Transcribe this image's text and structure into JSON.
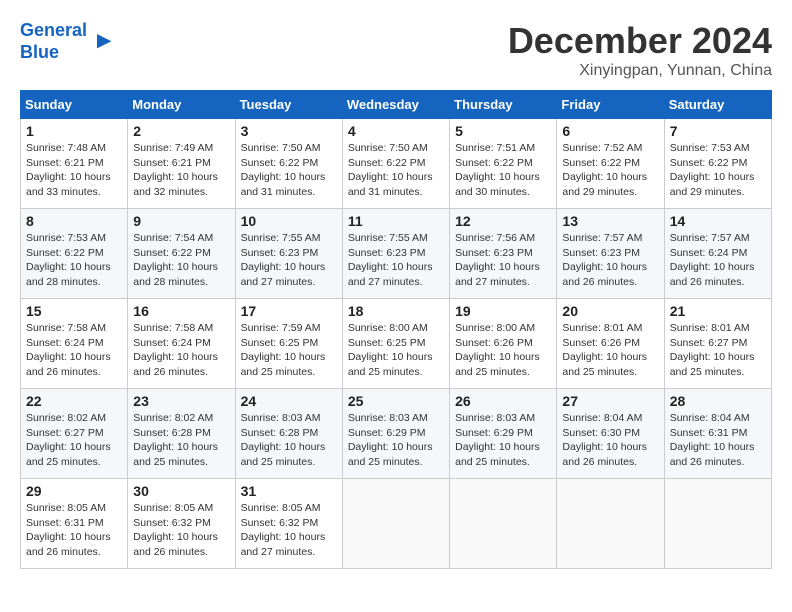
{
  "header": {
    "logo_line1": "General",
    "logo_line2": "Blue",
    "month": "December 2024",
    "location": "Xinyingpan, Yunnan, China"
  },
  "weekdays": [
    "Sunday",
    "Monday",
    "Tuesday",
    "Wednesday",
    "Thursday",
    "Friday",
    "Saturday"
  ],
  "weeks": [
    [
      {
        "day": "1",
        "info": "Sunrise: 7:48 AM\nSunset: 6:21 PM\nDaylight: 10 hours\nand 33 minutes."
      },
      {
        "day": "2",
        "info": "Sunrise: 7:49 AM\nSunset: 6:21 PM\nDaylight: 10 hours\nand 32 minutes."
      },
      {
        "day": "3",
        "info": "Sunrise: 7:50 AM\nSunset: 6:22 PM\nDaylight: 10 hours\nand 31 minutes."
      },
      {
        "day": "4",
        "info": "Sunrise: 7:50 AM\nSunset: 6:22 PM\nDaylight: 10 hours\nand 31 minutes."
      },
      {
        "day": "5",
        "info": "Sunrise: 7:51 AM\nSunset: 6:22 PM\nDaylight: 10 hours\nand 30 minutes."
      },
      {
        "day": "6",
        "info": "Sunrise: 7:52 AM\nSunset: 6:22 PM\nDaylight: 10 hours\nand 29 minutes."
      },
      {
        "day": "7",
        "info": "Sunrise: 7:53 AM\nSunset: 6:22 PM\nDaylight: 10 hours\nand 29 minutes."
      }
    ],
    [
      {
        "day": "8",
        "info": "Sunrise: 7:53 AM\nSunset: 6:22 PM\nDaylight: 10 hours\nand 28 minutes."
      },
      {
        "day": "9",
        "info": "Sunrise: 7:54 AM\nSunset: 6:22 PM\nDaylight: 10 hours\nand 28 minutes."
      },
      {
        "day": "10",
        "info": "Sunrise: 7:55 AM\nSunset: 6:23 PM\nDaylight: 10 hours\nand 27 minutes."
      },
      {
        "day": "11",
        "info": "Sunrise: 7:55 AM\nSunset: 6:23 PM\nDaylight: 10 hours\nand 27 minutes."
      },
      {
        "day": "12",
        "info": "Sunrise: 7:56 AM\nSunset: 6:23 PM\nDaylight: 10 hours\nand 27 minutes."
      },
      {
        "day": "13",
        "info": "Sunrise: 7:57 AM\nSunset: 6:23 PM\nDaylight: 10 hours\nand 26 minutes."
      },
      {
        "day": "14",
        "info": "Sunrise: 7:57 AM\nSunset: 6:24 PM\nDaylight: 10 hours\nand 26 minutes."
      }
    ],
    [
      {
        "day": "15",
        "info": "Sunrise: 7:58 AM\nSunset: 6:24 PM\nDaylight: 10 hours\nand 26 minutes."
      },
      {
        "day": "16",
        "info": "Sunrise: 7:58 AM\nSunset: 6:24 PM\nDaylight: 10 hours\nand 26 minutes."
      },
      {
        "day": "17",
        "info": "Sunrise: 7:59 AM\nSunset: 6:25 PM\nDaylight: 10 hours\nand 25 minutes."
      },
      {
        "day": "18",
        "info": "Sunrise: 8:00 AM\nSunset: 6:25 PM\nDaylight: 10 hours\nand 25 minutes."
      },
      {
        "day": "19",
        "info": "Sunrise: 8:00 AM\nSunset: 6:26 PM\nDaylight: 10 hours\nand 25 minutes."
      },
      {
        "day": "20",
        "info": "Sunrise: 8:01 AM\nSunset: 6:26 PM\nDaylight: 10 hours\nand 25 minutes."
      },
      {
        "day": "21",
        "info": "Sunrise: 8:01 AM\nSunset: 6:27 PM\nDaylight: 10 hours\nand 25 minutes."
      }
    ],
    [
      {
        "day": "22",
        "info": "Sunrise: 8:02 AM\nSunset: 6:27 PM\nDaylight: 10 hours\nand 25 minutes."
      },
      {
        "day": "23",
        "info": "Sunrise: 8:02 AM\nSunset: 6:28 PM\nDaylight: 10 hours\nand 25 minutes."
      },
      {
        "day": "24",
        "info": "Sunrise: 8:03 AM\nSunset: 6:28 PM\nDaylight: 10 hours\nand 25 minutes."
      },
      {
        "day": "25",
        "info": "Sunrise: 8:03 AM\nSunset: 6:29 PM\nDaylight: 10 hours\nand 25 minutes."
      },
      {
        "day": "26",
        "info": "Sunrise: 8:03 AM\nSunset: 6:29 PM\nDaylight: 10 hours\nand 25 minutes."
      },
      {
        "day": "27",
        "info": "Sunrise: 8:04 AM\nSunset: 6:30 PM\nDaylight: 10 hours\nand 26 minutes."
      },
      {
        "day": "28",
        "info": "Sunrise: 8:04 AM\nSunset: 6:31 PM\nDaylight: 10 hours\nand 26 minutes."
      }
    ],
    [
      {
        "day": "29",
        "info": "Sunrise: 8:05 AM\nSunset: 6:31 PM\nDaylight: 10 hours\nand 26 minutes."
      },
      {
        "day": "30",
        "info": "Sunrise: 8:05 AM\nSunset: 6:32 PM\nDaylight: 10 hours\nand 26 minutes."
      },
      {
        "day": "31",
        "info": "Sunrise: 8:05 AM\nSunset: 6:32 PM\nDaylight: 10 hours\nand 27 minutes."
      },
      null,
      null,
      null,
      null
    ]
  ]
}
